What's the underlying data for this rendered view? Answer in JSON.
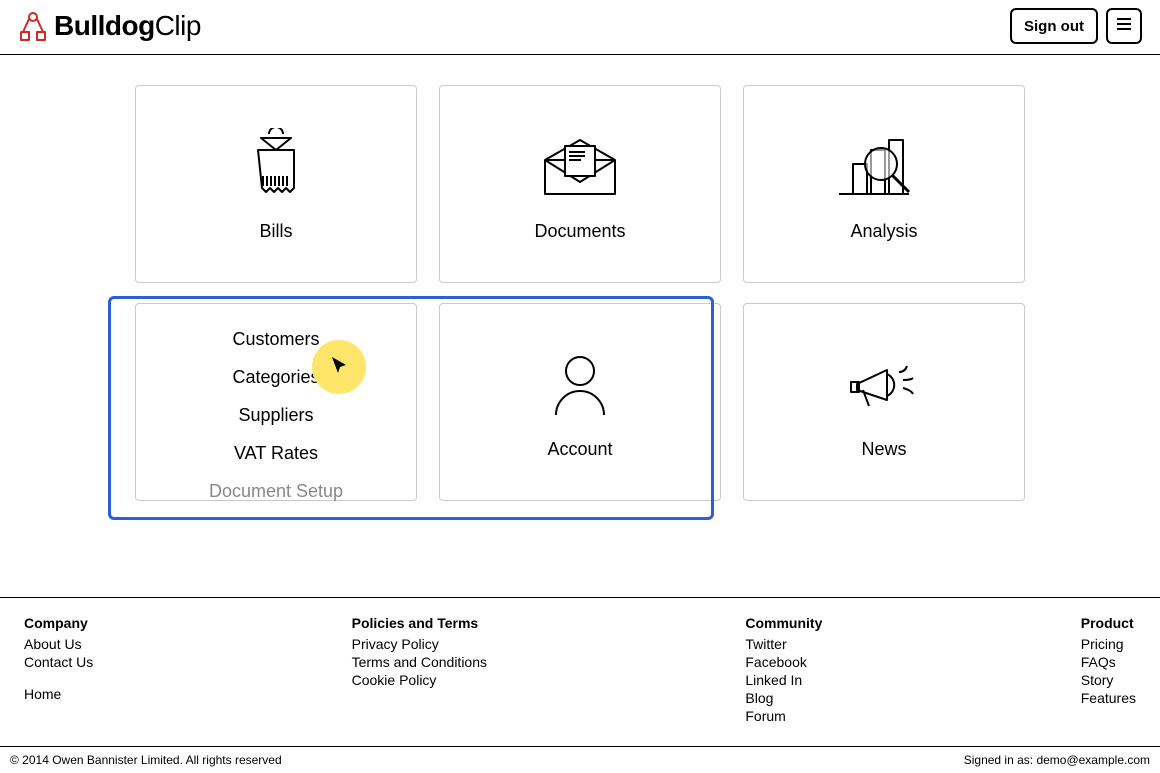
{
  "brand": {
    "bold": "Bulldog",
    "light": "Clip"
  },
  "header": {
    "signout": "Sign out"
  },
  "cards": {
    "bills": "Bills",
    "documents": "Documents",
    "analysis": "Analysis",
    "account": "Account",
    "news": "News"
  },
  "settings_items": [
    {
      "label": "Customers",
      "muted": false
    },
    {
      "label": "Categories",
      "muted": false
    },
    {
      "label": "Suppliers",
      "muted": false
    },
    {
      "label": "VAT Rates",
      "muted": false
    },
    {
      "label": "Document Setup",
      "muted": true
    }
  ],
  "footer": {
    "cols": [
      {
        "title": "Company",
        "links": [
          "About Us",
          "Contact Us"
        ],
        "extra": [
          "Home"
        ]
      },
      {
        "title": "Policies and Terms",
        "links": [
          "Privacy Policy",
          "Terms and Conditions",
          "Cookie Policy"
        ]
      },
      {
        "title": "Community",
        "links": [
          "Twitter",
          "Facebook",
          "Linked In",
          "Blog",
          "Forum"
        ]
      },
      {
        "title": "Product",
        "links": [
          "Pricing",
          "FAQs",
          "Story",
          "Features"
        ]
      }
    ]
  },
  "bottom": {
    "copyright": "© 2014 Owen Bannister Limited. All rights reserved",
    "signed_in_prefix": "Signed in as: ",
    "signed_in_user": "demo@example.com"
  }
}
